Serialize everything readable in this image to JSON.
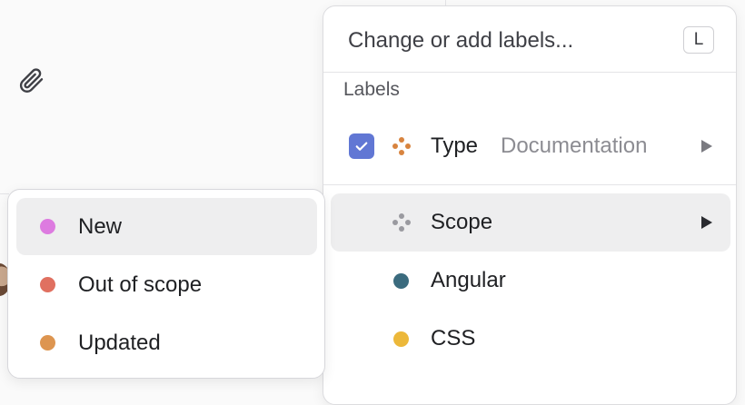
{
  "search": {
    "placeholder": "Change or add labels...",
    "shortcut": "L"
  },
  "section_title": "Labels",
  "items": [
    {
      "label": "Type",
      "value": "Documentation",
      "checked": true,
      "icon": "label-group-icon",
      "icon_color": "#d8843f"
    },
    {
      "label": "Scope",
      "icon": "label-group-icon",
      "icon_color": "#9a9aa0",
      "highlighted": true
    },
    {
      "label": "Angular",
      "color": "#3b6b7e"
    },
    {
      "label": "CSS",
      "color": "#ecb83a"
    }
  ],
  "submenu": {
    "items": [
      {
        "label": "New",
        "color": "#dd7be0",
        "highlighted": true
      },
      {
        "label": "Out of scope",
        "color": "#e07060"
      },
      {
        "label": "Updated",
        "color": "#dd9550"
      }
    ]
  },
  "background": {
    "attachment_icon": "paperclip-icon"
  }
}
